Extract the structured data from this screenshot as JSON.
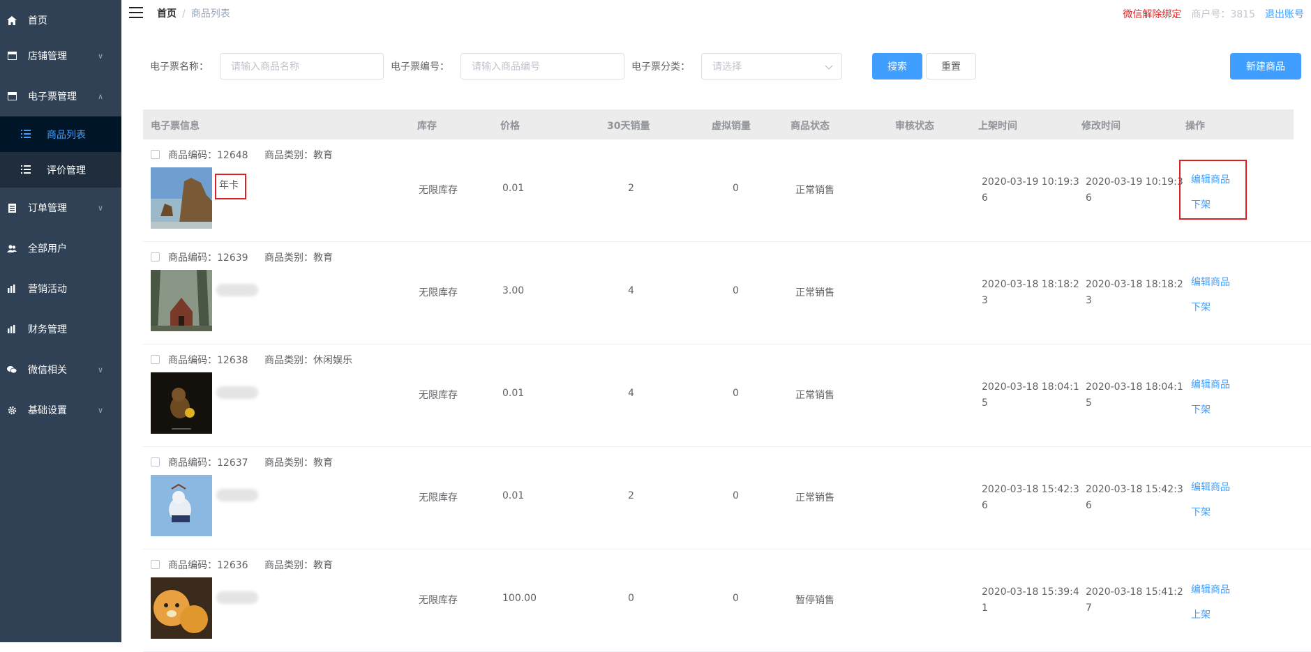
{
  "sidebar": {
    "items": [
      {
        "label": "首页",
        "icon": "home-icon",
        "has_arrow": false
      },
      {
        "label": "店铺管理",
        "icon": "shop-icon",
        "has_arrow": true
      },
      {
        "label": "电子票管理",
        "icon": "ticket-icon",
        "has_arrow": true,
        "expanded": true
      },
      {
        "label": "订单管理",
        "icon": "order-icon",
        "has_arrow": true
      },
      {
        "label": "全部用户",
        "icon": "users-icon",
        "has_arrow": false
      },
      {
        "label": "营销活动",
        "icon": "chart-icon",
        "has_arrow": false
      },
      {
        "label": "财务管理",
        "icon": "chart-icon",
        "has_arrow": false
      },
      {
        "label": "微信相关",
        "icon": "wechat-icon",
        "has_arrow": true
      },
      {
        "label": "基础设置",
        "icon": "gear-icon",
        "has_arrow": true
      }
    ],
    "sub_items": [
      {
        "label": "商品列表",
        "active": true
      },
      {
        "label": "评价管理",
        "active": false
      }
    ],
    "arrow_down": "∨",
    "arrow_up": "∧"
  },
  "header": {
    "breadcrumb_home": "首页",
    "breadcrumb_sep": "/",
    "breadcrumb_current": "商品列表",
    "unbind_wechat": "微信解除绑定",
    "merchant_id": "商户号：3815",
    "logout": "退出账号"
  },
  "filters": {
    "name_label": "电子票名称：",
    "name_placeholder": "请输入商品名称",
    "code_label": "电子票编号：",
    "code_placeholder": "请输入商品编号",
    "category_label": "电子票分类：",
    "category_placeholder": "请选择",
    "search_button": "搜索",
    "reset_button": "重置",
    "new_button": "新建商品"
  },
  "table": {
    "headers": [
      "电子票信息",
      "库存",
      "价格",
      "30天销量",
      "虚拟销量",
      "商品状态",
      "审核状态",
      "上架时间",
      "修改时间",
      "操作"
    ],
    "code_prefix": "商品编码：",
    "category_prefix": "商品类别：",
    "edit_label": "编辑商品",
    "rows": [
      {
        "code": "12648",
        "category": "教育",
        "name": "年卡",
        "stock": "无限库存",
        "price": "0.01",
        "sales30": "2",
        "virtual_sales": "0",
        "status": "正常销售",
        "audit": "",
        "listed_time": "2020-03-19 10:19:36",
        "modified_time": "2020-03-19 10:19:36",
        "action2": "下架",
        "thumb": "coast"
      },
      {
        "code": "12639",
        "category": "教育",
        "name": "",
        "stock": "无限库存",
        "price": "3.00",
        "sales30": "4",
        "virtual_sales": "0",
        "status": "正常销售",
        "audit": "",
        "listed_time": "2020-03-18 18:18:23",
        "modified_time": "2020-03-18 18:18:23",
        "action2": "下架",
        "thumb": "forest"
      },
      {
        "code": "12638",
        "category": "休闲娱乐",
        "name": "",
        "stock": "无限库存",
        "price": "0.01",
        "sales30": "4",
        "virtual_sales": "0",
        "status": "正常销售",
        "audit": "",
        "listed_time": "2020-03-18 18:04:15",
        "modified_time": "2020-03-18 18:04:15",
        "action2": "下架",
        "thumb": "bear"
      },
      {
        "code": "12637",
        "category": "教育",
        "name": "",
        "stock": "无限库存",
        "price": "0.01",
        "sales30": "2",
        "virtual_sales": "0",
        "status": "正常销售",
        "audit": "",
        "listed_time": "2020-03-18 15:42:36",
        "modified_time": "2020-03-18 15:42:36",
        "action2": "下架",
        "thumb": "polar"
      },
      {
        "code": "12636",
        "category": "教育",
        "name": "",
        "stock": "无限库存",
        "price": "100.00",
        "sales30": "0",
        "virtual_sales": "0",
        "status": "暂停销售",
        "audit": "",
        "listed_time": "2020-03-18 15:39:41",
        "modified_time": "2020-03-18 15:41:27",
        "action2": "上架",
        "thumb": "plush"
      }
    ]
  },
  "colors": {
    "sidebar": "#304156",
    "accent": "#409eff",
    "highlight": "#e02020"
  }
}
